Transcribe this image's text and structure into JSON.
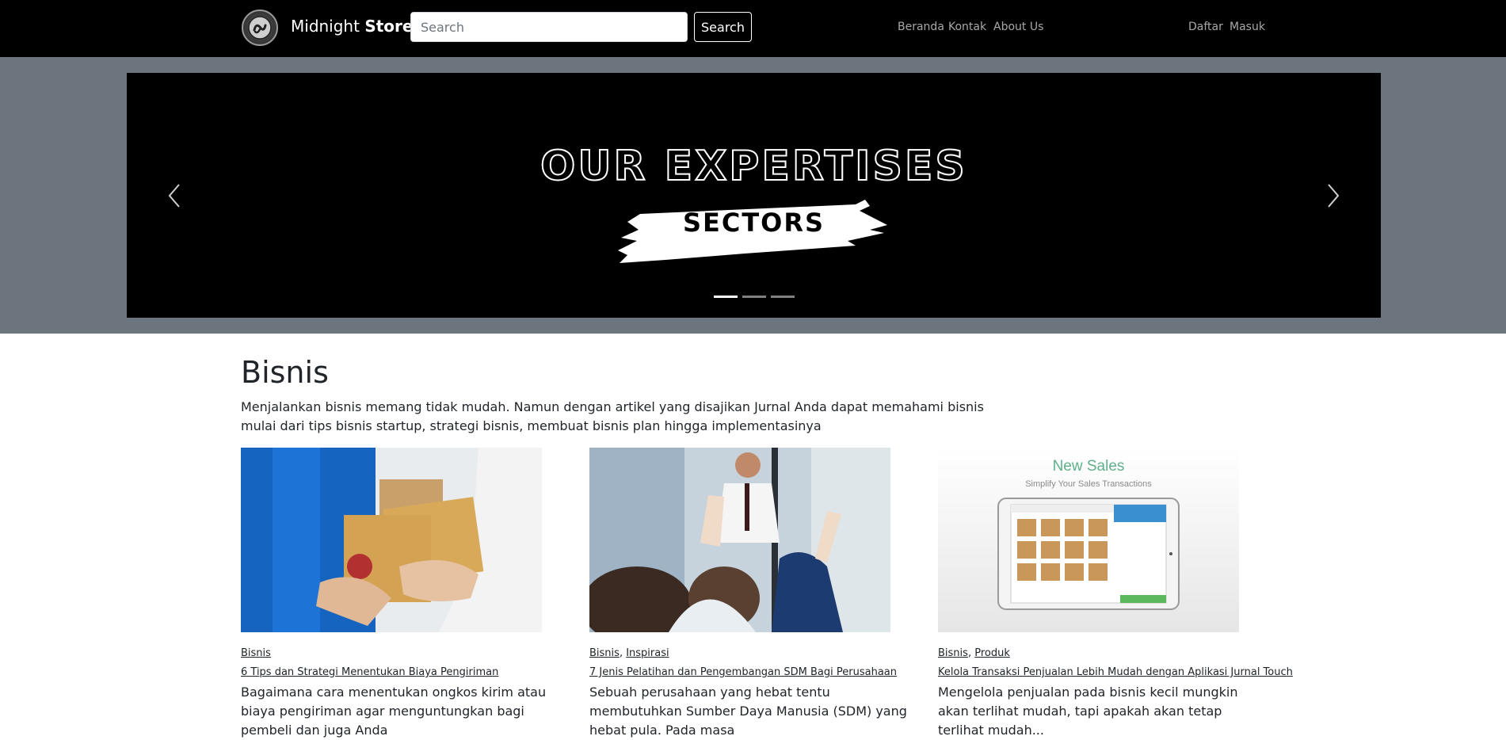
{
  "navbar": {
    "brand_light": "Midnight",
    "brand_bold": "Store",
    "search_placeholder": "Search",
    "search_button": "Search",
    "links": [
      "Beranda",
      "Kontak",
      "About Us"
    ],
    "auth_links": [
      "Daftar",
      "Masuk"
    ]
  },
  "carousel": {
    "slide_title": "OUR EXPERTISES",
    "slide_subtitle": "SECTORS",
    "slide_count": 3,
    "active_index": 0
  },
  "section": {
    "title": "Bisnis",
    "description": "Menjalankan bisnis memang tidak mudah. Namun dengan artikel yang disajikan Jurnal Anda dapat memahami bisnis mulai dari tips bisnis startup, strategi bisnis, membuat bisnis plan hingga implementasinya"
  },
  "articles": [
    {
      "categories": [
        "Bisnis"
      ],
      "title": "6 Tips dan Strategi Menentukan Biaya Pengiriman",
      "excerpt": "Bagaimana cara menentukan ongkos kirim atau biaya pengiriman agar menguntungkan bagi pembeli dan juga Anda"
    },
    {
      "categories": [
        "Bisnis",
        "Inspirasi"
      ],
      "title": "7 Jenis Pelatihan dan Pengembangan SDM Bagi Perusahaan",
      "excerpt": "Sebuah perusahaan yang hebat tentu membutuhkan Sumber Daya Manusia (SDM) yang hebat pula. Pada masa"
    },
    {
      "categories": [
        "Bisnis",
        "Produk"
      ],
      "title": "Kelola Transaksi Penjualan Lebih Mudah dengan Aplikasi Jurnal Touch",
      "excerpt": "Mengelola penjualan pada bisnis kecil mungkin akan terlihat mudah, tapi apakah akan tetap terlihat mudah...",
      "image_heading": "New Sales",
      "image_subheading": "Simplify Your Sales Transactions"
    }
  ],
  "colors": {
    "navbar_bg": "#000000",
    "jumbotron_bg": "#6c757d",
    "accent_green": "#5cb85c"
  }
}
